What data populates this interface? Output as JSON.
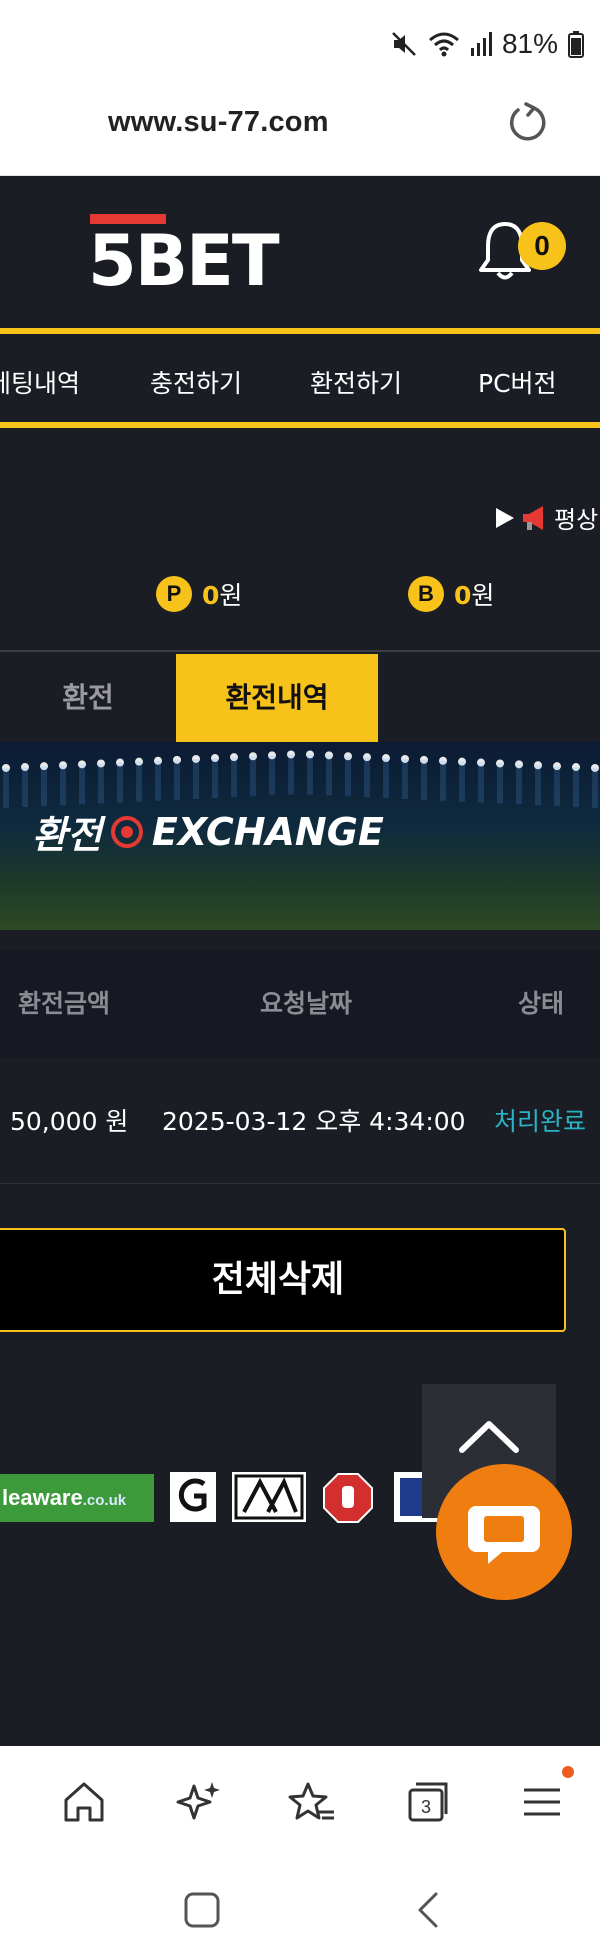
{
  "status_bar": {
    "battery": "81%"
  },
  "browser": {
    "url": "www.su-77.com"
  },
  "header": {
    "logo": "5BET",
    "notification_count": "0"
  },
  "nav": {
    "items": [
      "베팅내역",
      "충전하기",
      "환전하기",
      "PC버전"
    ]
  },
  "notice": {
    "text": "평상"
  },
  "balances": {
    "points": {
      "icon": "P",
      "amount": "0",
      "unit": "원"
    },
    "bonus": {
      "icon": "B",
      "amount": "0",
      "unit": "원"
    }
  },
  "tabs": {
    "exchange": "환전",
    "history": "환전내역"
  },
  "banner": {
    "title_ko": "환전",
    "title_en": "EXCHANGE"
  },
  "table": {
    "headers": [
      "환전금액",
      "요청날짜",
      "상태"
    ],
    "rows": [
      {
        "amount": "50,000 원",
        "date": "2025-03-12 오후 4:34:00",
        "status": "처리완료"
      }
    ]
  },
  "actions": {
    "delete_all": "전체삭제"
  },
  "footer_logos": {
    "begambleaware": "leaware",
    "begambleaware_domain": ".co.uk"
  },
  "colors": {
    "accent": "#f7c21a",
    "status_done": "#2ab3c4",
    "chat": "#ef7d0f",
    "background": "#1b1d25"
  }
}
